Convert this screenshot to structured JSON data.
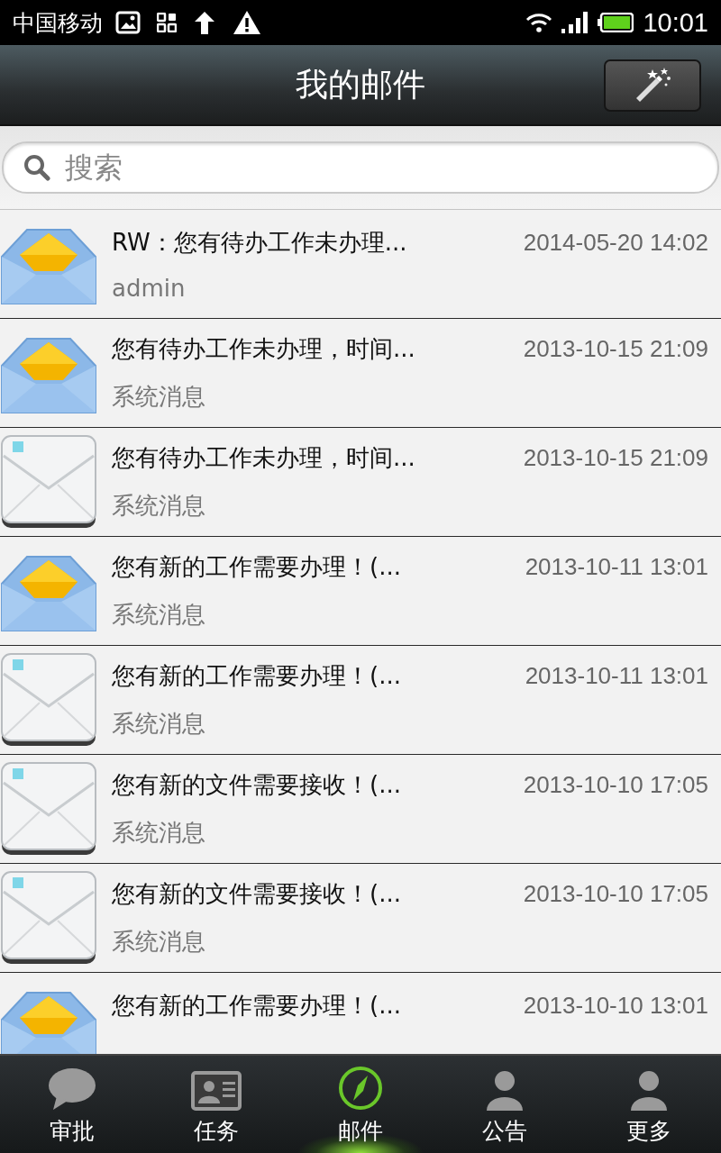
{
  "status_bar": {
    "carrier": "中国移动",
    "time": "10:01"
  },
  "header": {
    "title": "我的邮件"
  },
  "search": {
    "placeholder": "搜索"
  },
  "mails": [
    {
      "opened": true,
      "title": "RW：您有待办工作未办理...",
      "sender": "admin",
      "date": "2014-05-20 14:02"
    },
    {
      "opened": true,
      "title": "您有待办工作未办理，时间...",
      "sender": "系统消息",
      "date": "2013-10-15 21:09"
    },
    {
      "opened": false,
      "title": "您有待办工作未办理，时间...",
      "sender": "系统消息",
      "date": "2013-10-15 21:09"
    },
    {
      "opened": true,
      "title": "您有新的工作需要办理！(...",
      "sender": "系统消息",
      "date": "2013-10-11 13:01"
    },
    {
      "opened": false,
      "title": "您有新的工作需要办理！(...",
      "sender": "系统消息",
      "date": "2013-10-11 13:01"
    },
    {
      "opened": false,
      "title": "您有新的文件需要接收！(...",
      "sender": "系统消息",
      "date": "2013-10-10 17:05"
    },
    {
      "opened": false,
      "title": "您有新的文件需要接收！(...",
      "sender": "系统消息",
      "date": "2013-10-10 17:05"
    },
    {
      "opened": true,
      "title": "您有新的工作需要办理！(...",
      "date": "2013-10-10 13:01"
    }
  ],
  "tabs": [
    {
      "kind": "bubble",
      "label": "审批",
      "selected": false
    },
    {
      "kind": "card",
      "label": "任务",
      "selected": false
    },
    {
      "kind": "compass",
      "label": "邮件",
      "selected": true
    },
    {
      "kind": "person",
      "label": "公告",
      "selected": false
    },
    {
      "kind": "person",
      "label": "更多",
      "selected": false
    }
  ]
}
